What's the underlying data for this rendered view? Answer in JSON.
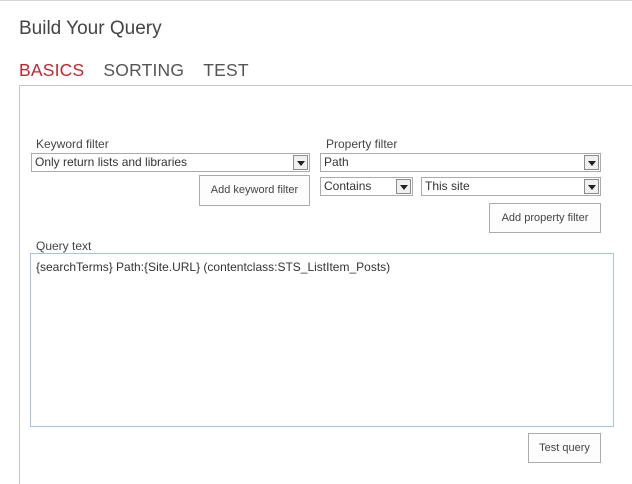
{
  "page": {
    "title": "Build Your Query"
  },
  "tabs": [
    {
      "label": "BASICS",
      "active": true
    },
    {
      "label": "SORTING",
      "active": false
    },
    {
      "label": "TEST",
      "active": false
    }
  ],
  "keyword_filter": {
    "label": "Keyword filter",
    "selected": "Only return lists and libraries",
    "add_button": "Add keyword filter"
  },
  "property_filter": {
    "label": "Property filter",
    "property_selected": "Path",
    "operator_selected": "Contains",
    "value_selected": "This site",
    "add_button": "Add property filter"
  },
  "query_text": {
    "label": "Query text",
    "value": "{searchTerms} Path:{Site.URL} (contentclass:STS_ListItem_Posts)"
  },
  "test_button": "Test query",
  "colors": {
    "active_tab": "#c4262e",
    "text": "#444444",
    "border": "#ababab",
    "textarea_border": "#a9c3d9"
  }
}
